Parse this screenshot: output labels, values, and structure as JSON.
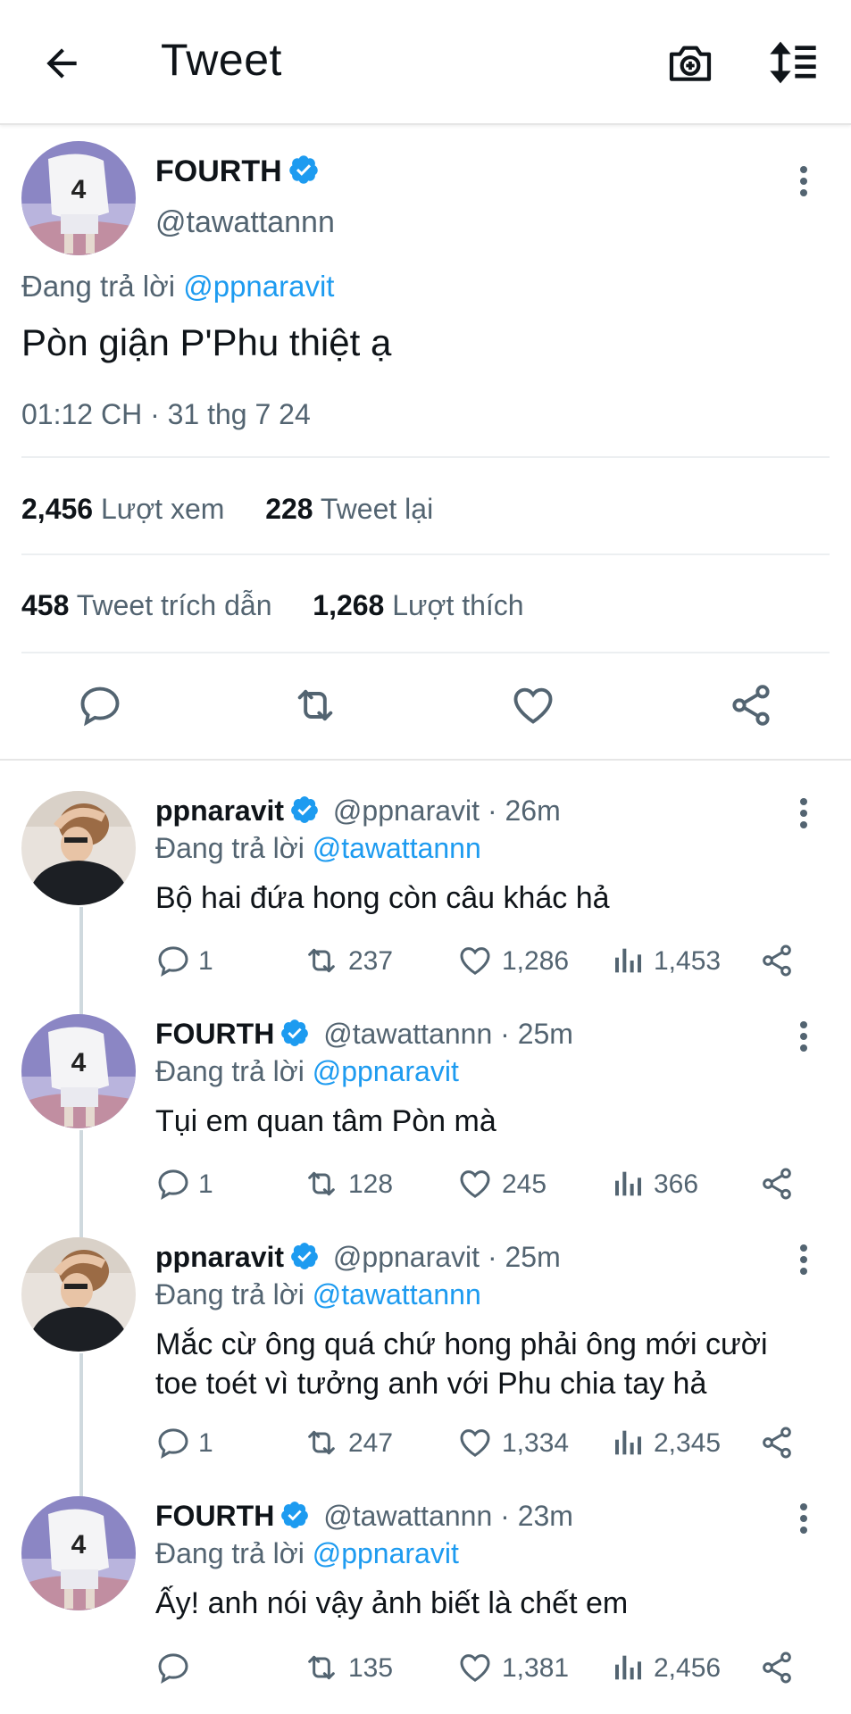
{
  "header": {
    "title": "Tweet",
    "icons": [
      "back-arrow-icon",
      "camera-plus-icon",
      "sort-icon"
    ]
  },
  "main_tweet": {
    "name": "FOURTH",
    "handle": "@tawattannn",
    "reply_prefix": "Đang trả lời",
    "reply_to": "@ppnaravit",
    "text": "Pòn giận P'Phu thiệt ạ",
    "timestamp": "01:12 CH · 31 thg 7 24",
    "views_num": "2,456",
    "views_lbl": "Lượt xem",
    "retweets_num": "228",
    "retweets_lbl": "Tweet lại",
    "quotes_num": "458",
    "quotes_lbl": "Tweet trích dẫn",
    "likes_num": "1,268",
    "likes_lbl": "Lượt thích"
  },
  "replies": [
    {
      "name": "ppnaravit",
      "handle_time": "@ppnaravit · 26m",
      "reply_prefix": "Đang trả lời",
      "reply_to": "@tawattannn",
      "text": "Bộ hai đứa hong còn câu khác hả",
      "replies": "1",
      "retweets": "237",
      "likes": "1,286",
      "views": "1,453"
    },
    {
      "name": "FOURTH",
      "handle_time": "@tawattannn · 25m",
      "reply_prefix": "Đang trả lời",
      "reply_to": "@ppnaravit",
      "text": "Tụi em quan tâm Pòn mà",
      "replies": "1",
      "retweets": "128",
      "likes": "245",
      "views": "366"
    },
    {
      "name": "ppnaravit",
      "handle_time": "@ppnaravit · 25m",
      "reply_prefix": "Đang trả lời",
      "reply_to": "@tawattannn",
      "text_line1": "Mắc cừ ông quá chứ hong phải ông mới cười",
      "text_line2": "toe toét vì tưởng anh với Phu chia tay hả",
      "replies": "1",
      "retweets": "247",
      "likes": "1,334",
      "views": "2,345"
    },
    {
      "name": "FOURTH",
      "handle_time": "@tawattannn · 23m",
      "reply_prefix": "Đang trả lời",
      "reply_to": "@ppnaravit",
      "text": "Ấy! anh nói vậy ảnh biết là chết em",
      "replies": "",
      "retweets": "135",
      "likes": "1,381",
      "views": "2,456"
    }
  ],
  "colors": {
    "accent": "#1d9bf0",
    "text": "#0f1419",
    "muted": "#536471"
  }
}
